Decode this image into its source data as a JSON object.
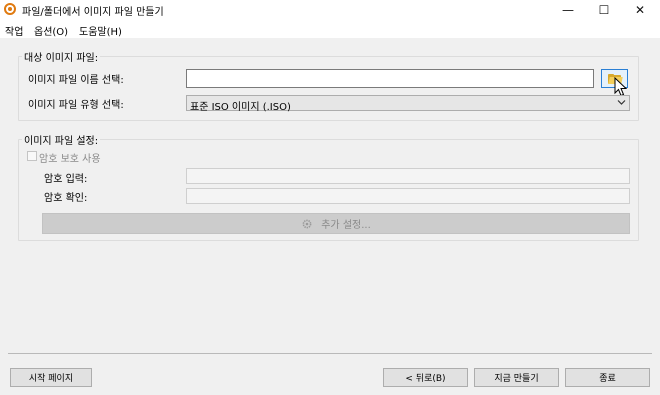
{
  "window": {
    "title": "파일/폴더에서 이미지 파일 만들기",
    "minimize": "—",
    "maximize": "☐",
    "close": "✕"
  },
  "menu": {
    "items": [
      "작업",
      "옵션(O)",
      "도움말(H)"
    ]
  },
  "target_group": {
    "title": "대상 이미지 파일:",
    "name_label": "이미지 파일 이름 선택:",
    "name_value": "",
    "type_label": "이미지 파일 유형 선택:",
    "type_value": "표준 ISO 이미지 (.ISO)",
    "browse_icon": "folder-open-icon"
  },
  "settings_group": {
    "title": "이미지 파일 설정:",
    "password_checkbox_label": "암호 보호 사용",
    "password_checked": false,
    "password_label": "암호 입력:",
    "confirm_label": "암호 확인:",
    "advanced_button": "추가 설정...",
    "advanced_icon": "gear-icon"
  },
  "footer": {
    "start_page": "시작 페이지",
    "back": "< 뒤로(B)",
    "create_now": "지금 만들기",
    "finish": "종료"
  }
}
